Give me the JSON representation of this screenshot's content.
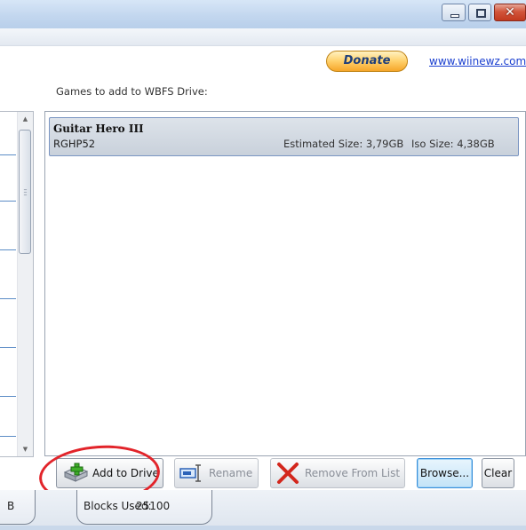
{
  "window": {
    "close_glyph": "✕",
    "control_icons": [
      "minimize-icon",
      "maximize-icon",
      "close-icon"
    ]
  },
  "header": {
    "donate_label": "Donate",
    "website_link": "www.wiinewz.com"
  },
  "main": {
    "games_label": "Games to add to WBFS Drive:",
    "games": [
      {
        "title": "Guitar Hero III",
        "id": "RGHP52",
        "estimated_size": "Estimated Size: 3,79GB",
        "iso_size": "Iso Size: 4,38GB"
      }
    ]
  },
  "toolbar": {
    "add_to_drive_label": "Add to Drive",
    "rename_label": "Rename",
    "remove_label": "Remove From List",
    "browse_label": "Browse...",
    "clear_label": "Clear",
    "icons": {
      "add": "drive-add-icon",
      "rename": "rename-icon",
      "remove": "red-x-icon"
    }
  },
  "status": {
    "first_cell_tail": "B",
    "blocks_used_label": "Blocks Used:",
    "blocks_used_value": "25100"
  },
  "colors": {
    "annotation_circle": "#e2242a",
    "link": "#1a3fd0",
    "selection": "#c9d1db"
  }
}
